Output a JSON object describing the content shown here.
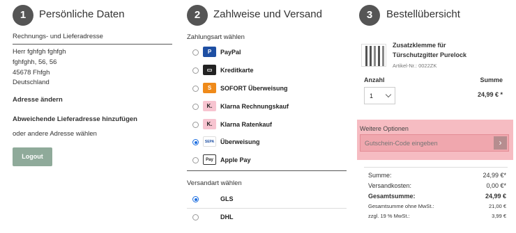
{
  "steps": [
    {
      "num": "1",
      "title": "Persönliche Daten"
    },
    {
      "num": "2",
      "title": "Zahlweise und Versand"
    },
    {
      "num": "3",
      "title": "Bestellübersicht"
    }
  ],
  "personal": {
    "address_heading": "Rechnungs- und Lieferadresse",
    "address_lines": [
      "Herr fghfgh fghfgh",
      "fghfghh, 56, 56",
      "45678 Fhfgh",
      "Deutschland"
    ],
    "change_address": "Adresse ändern",
    "different_delivery": "Abweichende Lieferadresse hinzufügen",
    "other_address": "oder andere Adresse wählen",
    "logout": "Logout"
  },
  "payment": {
    "heading": "Zahlungsart wählen",
    "methods": [
      {
        "label": "PayPal",
        "icon": "paypal-icon",
        "color": "#1e4fa3",
        "glyph": "P",
        "checked": false
      },
      {
        "label": "Kreditkarte",
        "icon": "credit-card-icon",
        "color": "#222222",
        "glyph": "▭",
        "checked": false
      },
      {
        "label": "SOFORT Überweisung",
        "icon": "sofort-icon",
        "color": "#ef8a1a",
        "glyph": "S",
        "checked": false
      },
      {
        "label": "Klarna Rechnungskauf",
        "icon": "klarna-icon",
        "color": "#f7c4d0",
        "glyph": "K.",
        "checked": false
      },
      {
        "label": "Klarna Ratenkauf",
        "icon": "klarna-icon",
        "color": "#f7c4d0",
        "glyph": "K.",
        "checked": false
      },
      {
        "label": "Überweisung",
        "icon": "bank-transfer-icon",
        "color": "#ffffff",
        "glyph": "SEPA",
        "checked": true
      },
      {
        "label": "Apple Pay",
        "icon": "apple-pay-icon",
        "color": "#ffffff",
        "glyph": "Pay",
        "checked": false
      }
    ]
  },
  "shipping": {
    "heading": "Versandart wählen",
    "methods": [
      {
        "label": "GLS",
        "checked": true
      },
      {
        "label": "DHL",
        "checked": false
      }
    ]
  },
  "summary": {
    "product_name_1": "Zusatzklemme für",
    "product_name_2": "Türschutzgitter Purelock",
    "article_no": "Artikel-Nr.: 0022ZK",
    "qty_header": "Anzahl",
    "sum_header": "Summe",
    "qty_value": "1",
    "line_total": "24,99 € *",
    "options_label": "Weitere Optionen",
    "coupon_placeholder": "Gutschein-Code eingeben",
    "coupon_arrow": "›",
    "rows": [
      {
        "label": "Summe:",
        "value": "24,99 €*"
      },
      {
        "label": "Versandkosten:",
        "value": "0,00 €*"
      },
      {
        "label": "Gesamtsumme:",
        "value": "24,99 €"
      },
      {
        "label": "Gesamtsumme ohne MwSt.:",
        "value": "21,00 €"
      },
      {
        "label": "zzgl. 19 % MwSt.:",
        "value": "3,99 €"
      }
    ]
  },
  "colors": {
    "accent_button": "#8faa9a",
    "options_bg": "#f6bcc2",
    "radio_checked": "#1b6de0"
  }
}
